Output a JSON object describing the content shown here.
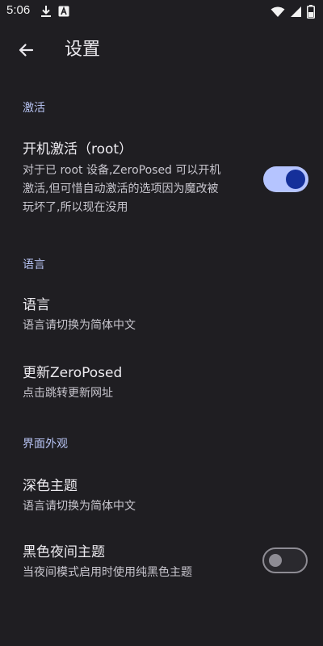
{
  "status_bar": {
    "time": "5:06",
    "icons": [
      "download-icon",
      "notification-a-icon",
      "wifi-icon",
      "signal-icon",
      "battery-icon"
    ]
  },
  "app_bar": {
    "title": "设置",
    "back_icon": "arrow-left-icon"
  },
  "sections": {
    "activation": {
      "header": "激活",
      "boot_activation": {
        "title": "开机激活（root）",
        "summary_lines": [
          "对于已 root 设备,ZeroPosed 可以开机",
          "激活,但可惜自动激活的选项因为魔改被",
          "玩坏了,所以现在没用"
        ],
        "enabled": true
      }
    },
    "language": {
      "header": "语言",
      "language_item": {
        "title": "语言",
        "summary": "语言请切换为简体中文"
      },
      "update_item": {
        "title": "更新ZeroPosed",
        "summary": "点击跳转更新网址"
      }
    },
    "appearance": {
      "header": "界面外观",
      "dark_theme": {
        "title": "深色主题",
        "summary": "语言请切换为简体中文"
      },
      "black_night_theme": {
        "title": "黑色夜间主题",
        "summary": "当夜间模式启用时使用纯黑色主题",
        "enabled": false
      }
    }
  },
  "colors": {
    "background": "#1f1e22",
    "accent": "#b7c3f3",
    "switch_on_track": "#b5c4ff",
    "switch_on_thumb": "#15309a",
    "switch_off_outline": "#8e8c94"
  }
}
